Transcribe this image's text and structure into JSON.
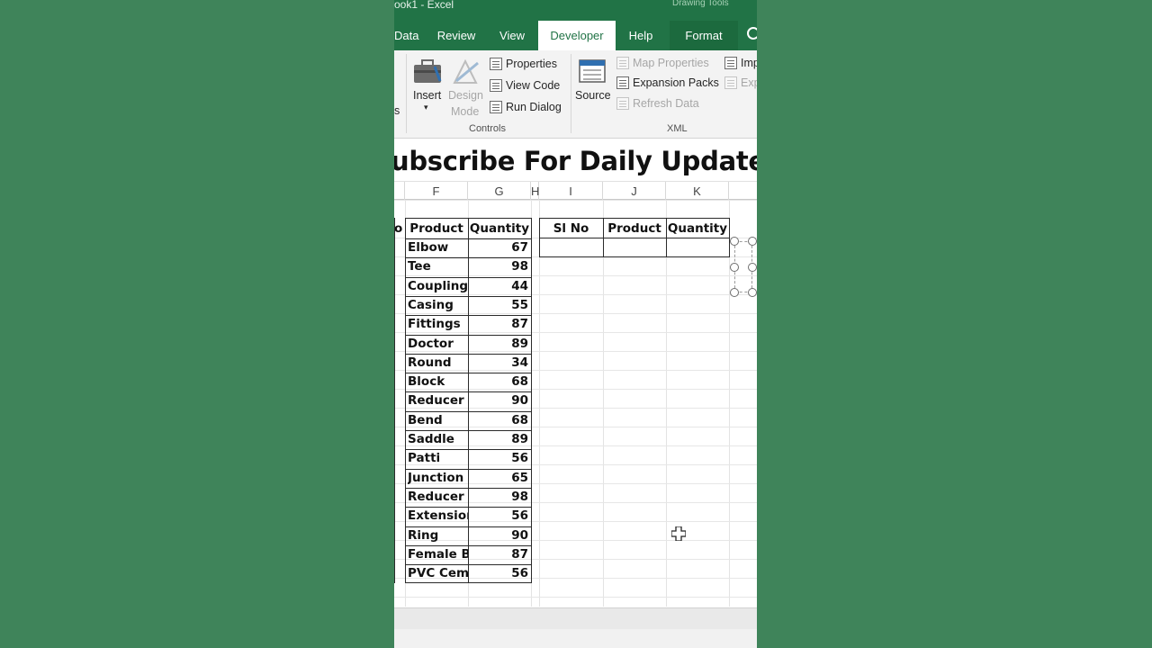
{
  "window": {
    "title": "ook1  -  Excel",
    "context_label": "Drawing Tools"
  },
  "tabs": [
    {
      "label": "Data"
    },
    {
      "label": "Review"
    },
    {
      "label": "View"
    },
    {
      "label": "Developer",
      "active": true
    },
    {
      "label": "Help"
    },
    {
      "label": "Format",
      "contextual": true
    }
  ],
  "ribbon": {
    "left_fragment": "s",
    "controls": {
      "insert_label": "Insert",
      "design_mode_line1": "Design",
      "design_mode_line2": "Mode",
      "properties": "Properties",
      "view_code": "View Code",
      "run_dialog": "Run Dialog",
      "group_label": "Controls"
    },
    "xml": {
      "source": "Source",
      "map_properties": "Map Properties",
      "expansion_packs": "Expansion Packs",
      "refresh_data": "Refresh Data",
      "import_fragment": "Imp",
      "export_fragment": "Exp",
      "group_label": "XML"
    }
  },
  "banner": "ubscribe For Daily Update",
  "columns": [
    "F",
    "G",
    "H",
    "I",
    "J",
    "K"
  ],
  "table1": {
    "left_fragment": "o",
    "headers": {
      "product": "Product",
      "quantity": "Quantity"
    },
    "rows": [
      {
        "product": "Elbow",
        "quantity": "67"
      },
      {
        "product": "Tee",
        "quantity": "98"
      },
      {
        "product": "Coupling",
        "quantity": "44"
      },
      {
        "product": "Casing",
        "quantity": "55"
      },
      {
        "product": "Fittings",
        "quantity": "87"
      },
      {
        "product": "Doctor",
        "quantity": "89"
      },
      {
        "product": "Round",
        "quantity": "34"
      },
      {
        "product": "Block",
        "quantity": "68"
      },
      {
        "product": "Reducer",
        "quantity": "90"
      },
      {
        "product": "Bend",
        "quantity": "68"
      },
      {
        "product": "Saddle",
        "quantity": "89"
      },
      {
        "product": "Patti",
        "quantity": "56"
      },
      {
        "product": "Junction B",
        "quantity": "65"
      },
      {
        "product": "Reducer",
        "quantity": "98"
      },
      {
        "product": "Extension",
        "quantity": "56"
      },
      {
        "product": "Ring",
        "quantity": "90"
      },
      {
        "product": "Female Bu",
        "quantity": "87"
      },
      {
        "product": "PVC Ceme",
        "quantity": "56"
      }
    ]
  },
  "table2": {
    "headers": {
      "sl_no": "Sl No",
      "product": "Product",
      "quantity": "Quantity"
    }
  },
  "colors": {
    "excel_green": "#217346",
    "background": "#3f845a"
  }
}
